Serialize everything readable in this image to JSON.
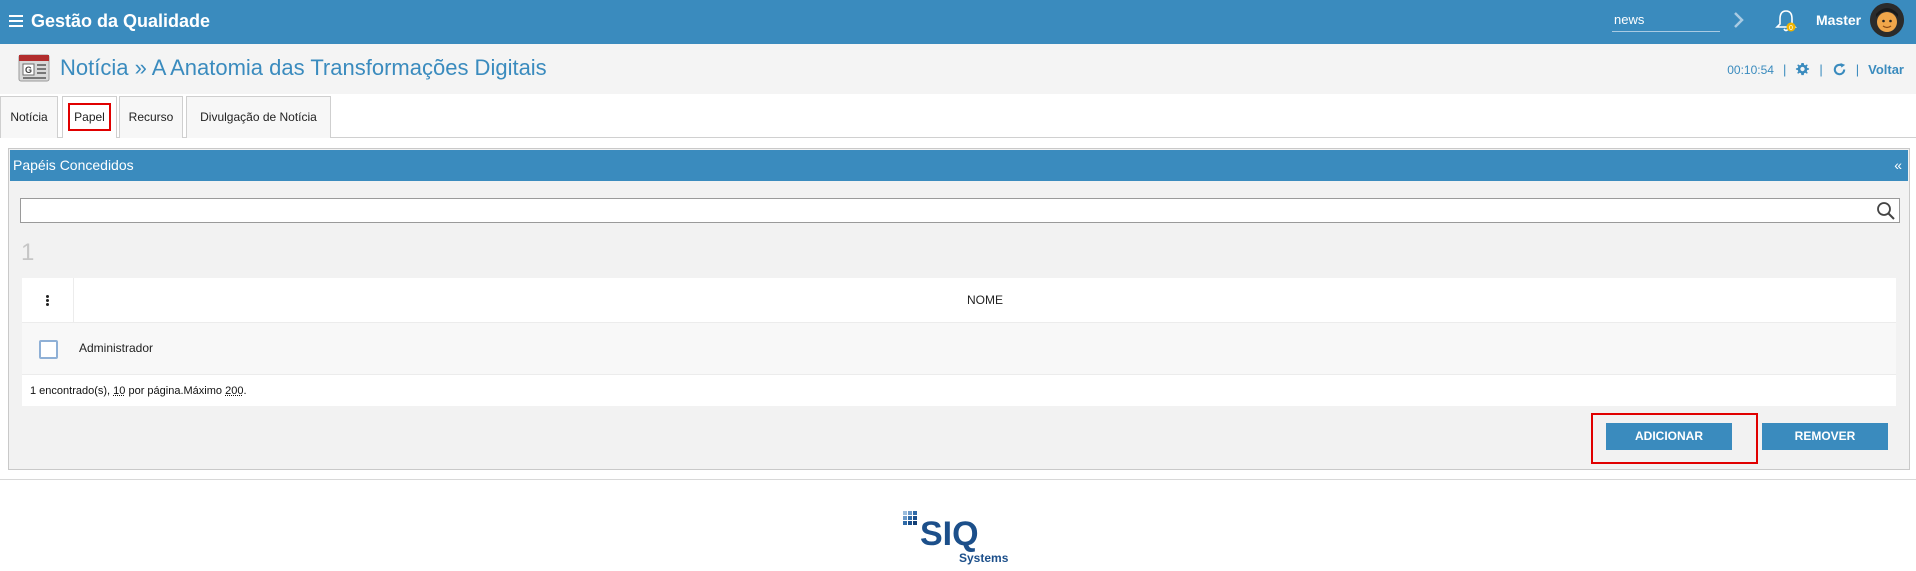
{
  "app": {
    "title": "Gestão da Qualidade"
  },
  "header": {
    "search_value": "news",
    "user_name": "Master",
    "notification_count": "0"
  },
  "page": {
    "title": "Notícia » A Anatomia das Transformações Digitais",
    "timer": "00:10:54",
    "back_label": "Voltar"
  },
  "tabs": [
    {
      "label": "Notícia"
    },
    {
      "label": "Papel"
    },
    {
      "label": "Recurso"
    },
    {
      "label": "Divulgação de Notícia"
    }
  ],
  "panel": {
    "title": "Papéis Concedidos",
    "collapse_label": "«",
    "count": "1",
    "column_header": "NOME",
    "rows": [
      {
        "name": "Administrador"
      }
    ],
    "footer": {
      "found": "1 encontrado(s), ",
      "per_page": "10",
      "per_page_suffix": " por página.Máximo ",
      "max": "200",
      "end": "."
    },
    "add_label": "ADICIONAR",
    "remove_label": "REMOVER"
  },
  "colors": {
    "brand": "#3a8bbe",
    "highlight": "#e00000"
  },
  "icons": [
    "menu-icon",
    "chevron-right-icon",
    "bell-icon",
    "avatar",
    "news-page-icon",
    "gear-icon",
    "refresh-icon",
    "search-icon",
    "kebab-icon",
    "checkbox"
  ],
  "logo": {
    "brand": "SIQ",
    "sub": "Systems"
  }
}
